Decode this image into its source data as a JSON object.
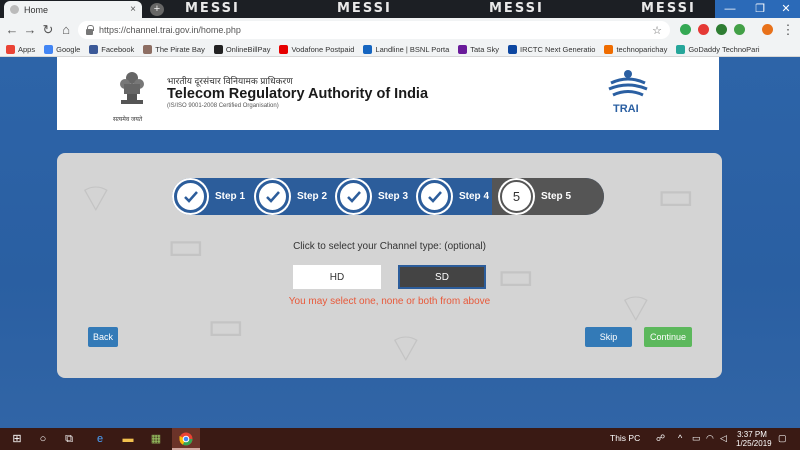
{
  "browser": {
    "tab_title": "Home",
    "tab_close": "×",
    "new_tab": "+",
    "theme_words": [
      "MESSI",
      "MESSI",
      "MESSI",
      "MESSI"
    ],
    "url": "https://channel.trai.gov.in/home.php",
    "window_controls": [
      "—",
      "❐",
      "✕"
    ],
    "nav": [
      "←",
      "→",
      "↻",
      "⌂"
    ],
    "star": "☆",
    "extension_colors": [
      "#34a853",
      "#e53935",
      "#2e7d32",
      "#43a047",
      "#e8711a"
    ]
  },
  "bookmarks": [
    {
      "label": "Apps",
      "icon": "apps-grid-icon",
      "color": "#ea4335"
    },
    {
      "label": "Google",
      "icon": "google-icon",
      "color": "#4285f4"
    },
    {
      "label": "Facebook",
      "icon": "facebook-icon",
      "color": "#3b5998"
    },
    {
      "label": "The Pirate Bay",
      "icon": "pirate-bay-icon",
      "color": "#8d6e63"
    },
    {
      "label": "OnlineBillPay",
      "icon": "onlinebillpay-icon",
      "color": "#222222"
    },
    {
      "label": "Vodafone Postpaid",
      "icon": "vodafone-icon",
      "color": "#e60000"
    },
    {
      "label": "Landline | BSNL Porta",
      "icon": "bsnl-icon",
      "color": "#1565c0"
    },
    {
      "label": "Tata Sky",
      "icon": "tata-sky-icon",
      "color": "#6a1b9a"
    },
    {
      "label": "IRCTC Next Generatio",
      "icon": "irctc-icon",
      "color": "#0d47a1"
    },
    {
      "label": "technoparichay",
      "icon": "technoparichay-icon",
      "color": "#ef6c00"
    },
    {
      "label": "GoDaddy TechnoPari",
      "icon": "godaddy-icon",
      "color": "#26a69a"
    }
  ],
  "header": {
    "hindi_name": "भारतीय दूरसंचार विनियामक प्राधिकरण",
    "org_name": "Telecom Regulatory Authority of India",
    "iso": "(IS/ISO 9001-2008 Certified Organisation)",
    "emblem_caption": "सत्यमेव जयते",
    "logo_text": "TRAI",
    "logo_color": "#2a5fa2"
  },
  "steps": [
    {
      "label": "Step 1",
      "done": true
    },
    {
      "label": "Step 2",
      "done": true
    },
    {
      "label": "Step 3",
      "done": true
    },
    {
      "label": "Step 4",
      "done": true
    },
    {
      "label": "Step 5",
      "number": "5",
      "done": false
    }
  ],
  "channel_type": {
    "prompt": "Click to select your Channel type:   (optional)",
    "options": [
      {
        "label": "HD",
        "selected": false
      },
      {
        "label": "SD",
        "selected": true
      }
    ],
    "hint": "You may select one, none or both from above",
    "hint_color": "#e8593a"
  },
  "actions": {
    "back": "Back",
    "skip": "Skip",
    "continue": "Continue"
  },
  "taskbar": {
    "this_pc": "This PC",
    "time": "3:37 PM",
    "date": "1/25/2019"
  }
}
